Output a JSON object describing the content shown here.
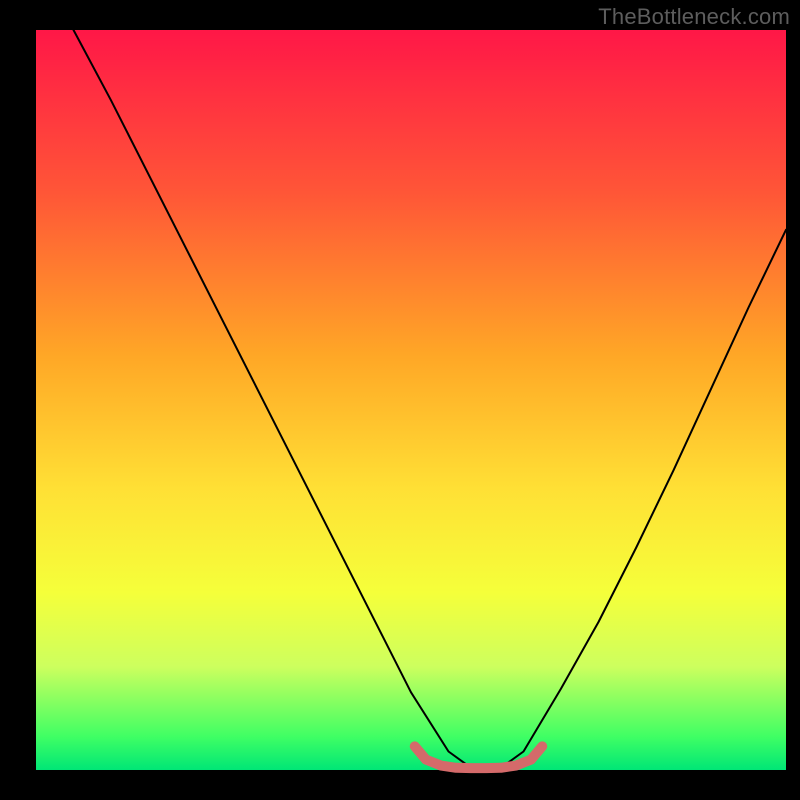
{
  "watermark": "TheBottleneck.com",
  "chart_data": {
    "type": "line",
    "title": "",
    "xlabel": "",
    "ylabel": "",
    "xlim": [
      0,
      100
    ],
    "ylim": [
      0,
      100
    ],
    "background_gradient": {
      "colors": [
        "#ff1747",
        "#ff5637",
        "#ffa726",
        "#ffe035",
        "#f5ff3a",
        "#cdff5e",
        "#3fff64",
        "#00e676"
      ],
      "stops": [
        0,
        0.22,
        0.44,
        0.62,
        0.76,
        0.86,
        0.955,
        1.0
      ]
    },
    "series": [
      {
        "name": "bottleneck-curve",
        "color": "#000000",
        "stroke_width": 2,
        "x": [
          5,
          10,
          15,
          20,
          25,
          30,
          35,
          40,
          45,
          50,
          55,
          58,
          62,
          65,
          70,
          75,
          80,
          85,
          90,
          95,
          100
        ],
        "values": [
          100,
          90.5,
          80.5,
          70.5,
          60.5,
          50.5,
          40.5,
          30.5,
          20.5,
          10.5,
          2.5,
          0.3,
          0.3,
          2.5,
          11,
          20,
          30,
          40.5,
          51.5,
          62.5,
          73
        ]
      },
      {
        "name": "optimal-zone-marker",
        "color": "#d46a6a",
        "stroke_width": 10,
        "x": [
          50.5,
          52,
          54,
          56,
          58,
          60,
          62,
          64,
          66,
          67.5
        ],
        "values": [
          3.2,
          1.4,
          0.6,
          0.3,
          0.25,
          0.25,
          0.3,
          0.6,
          1.4,
          3.2
        ]
      }
    ]
  }
}
